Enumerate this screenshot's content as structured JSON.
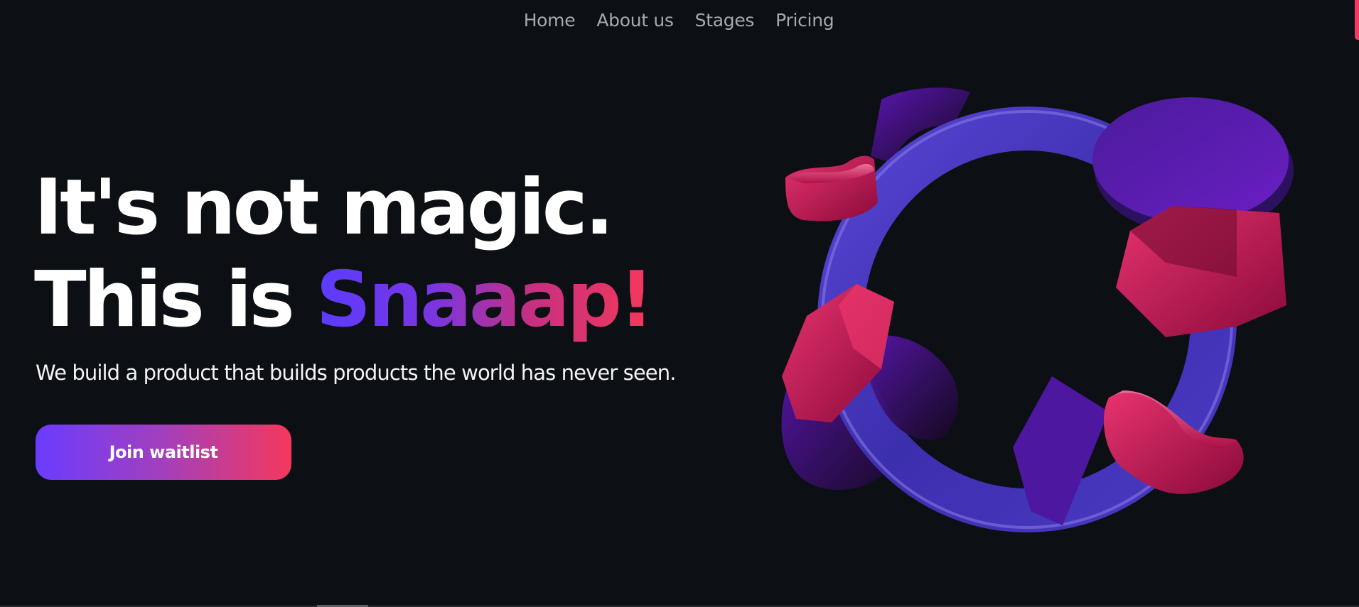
{
  "nav": {
    "items": [
      {
        "label": "Home"
      },
      {
        "label": "About us"
      },
      {
        "label": "Stages"
      },
      {
        "label": "Pricing"
      }
    ]
  },
  "hero": {
    "line1": "It's not magic.",
    "line2_prefix": "This is ",
    "brand": "Snaaap!",
    "subtitle": "We build a product that builds products the world has never seen.",
    "cta_label": "Join waitlist"
  },
  "colors": {
    "background": "#0c0f14",
    "accent_purple": "#5b3cff",
    "accent_pink": "#f4385c",
    "ring": "#4a38c8"
  },
  "illustration": {
    "icon": "abstract-3d-ring-shapes"
  }
}
